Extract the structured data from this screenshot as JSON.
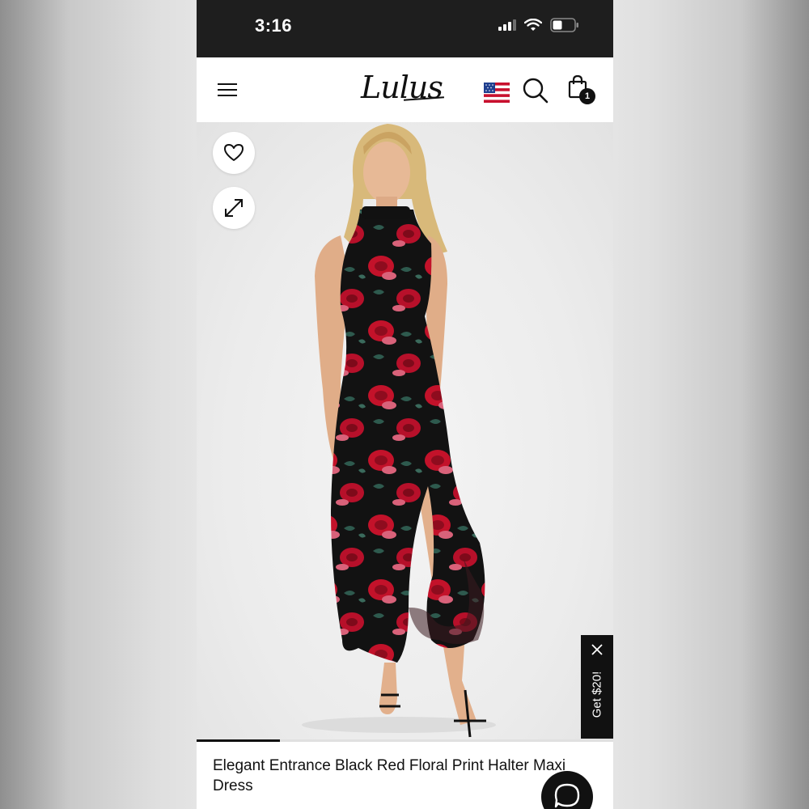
{
  "status_bar": {
    "time": "3:16",
    "icons": [
      "cellular-signal-icon",
      "wifi-icon",
      "battery-icon"
    ]
  },
  "nav": {
    "brand": "Lulus",
    "icons": [
      "hamburger-menu-icon",
      "us-flag-icon",
      "search-icon",
      "shopping-bag-icon"
    ],
    "cart_count": "1"
  },
  "product": {
    "image_icons": [
      "heart-icon",
      "expand-icon"
    ],
    "title": "Elegant Entrance Black Red Floral Print Halter Maxi Dress",
    "gallery_progress": 0.2
  },
  "promo": {
    "label": "Get $20!",
    "close_icon": "close-icon"
  },
  "chat": {
    "icon": "chat-bubble-icon"
  },
  "colors": {
    "status_bar": "#1e1e1e",
    "accent": "#111111",
    "dress_red": "#c3122a"
  }
}
